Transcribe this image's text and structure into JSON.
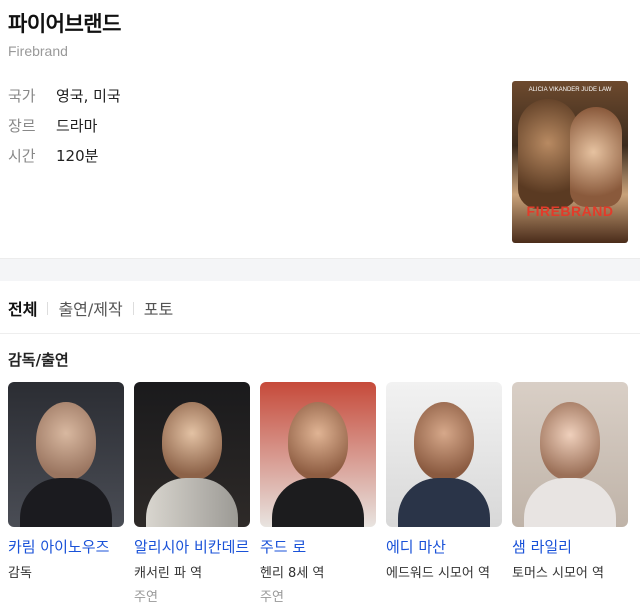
{
  "movie": {
    "title": "파이어브랜드",
    "original_title": "Firebrand"
  },
  "info": [
    {
      "key": "국가",
      "value": "영국, 미국"
    },
    {
      "key": "장르",
      "value": "드라마"
    },
    {
      "key": "시간",
      "value": "120분"
    }
  ],
  "poster": {
    "top_text": "ALICIA VIKANDER   JUDE LAW",
    "title_text": "FIREBRAND"
  },
  "tabs": [
    {
      "label": "전체",
      "active": true
    },
    {
      "label": "출연/제작",
      "active": false
    },
    {
      "label": "포토",
      "active": false
    }
  ],
  "section": {
    "title": "감독/출연"
  },
  "cast": [
    {
      "name": "카림 아이노우즈",
      "role": "감독",
      "kind": ""
    },
    {
      "name": "알리시아 비칸데르",
      "role": "캐서린 파 역",
      "kind": "주연"
    },
    {
      "name": "주드 로",
      "role": "헨리 8세 역",
      "kind": "주연"
    },
    {
      "name": "에디 마산",
      "role": "에드워드 시모어 역",
      "kind": ""
    },
    {
      "name": "샘 라일리",
      "role": "토머스 시모어 역",
      "kind": ""
    }
  ],
  "colors": {
    "link": "#1a52d8",
    "accent_poster_title": "#e23b2a"
  }
}
